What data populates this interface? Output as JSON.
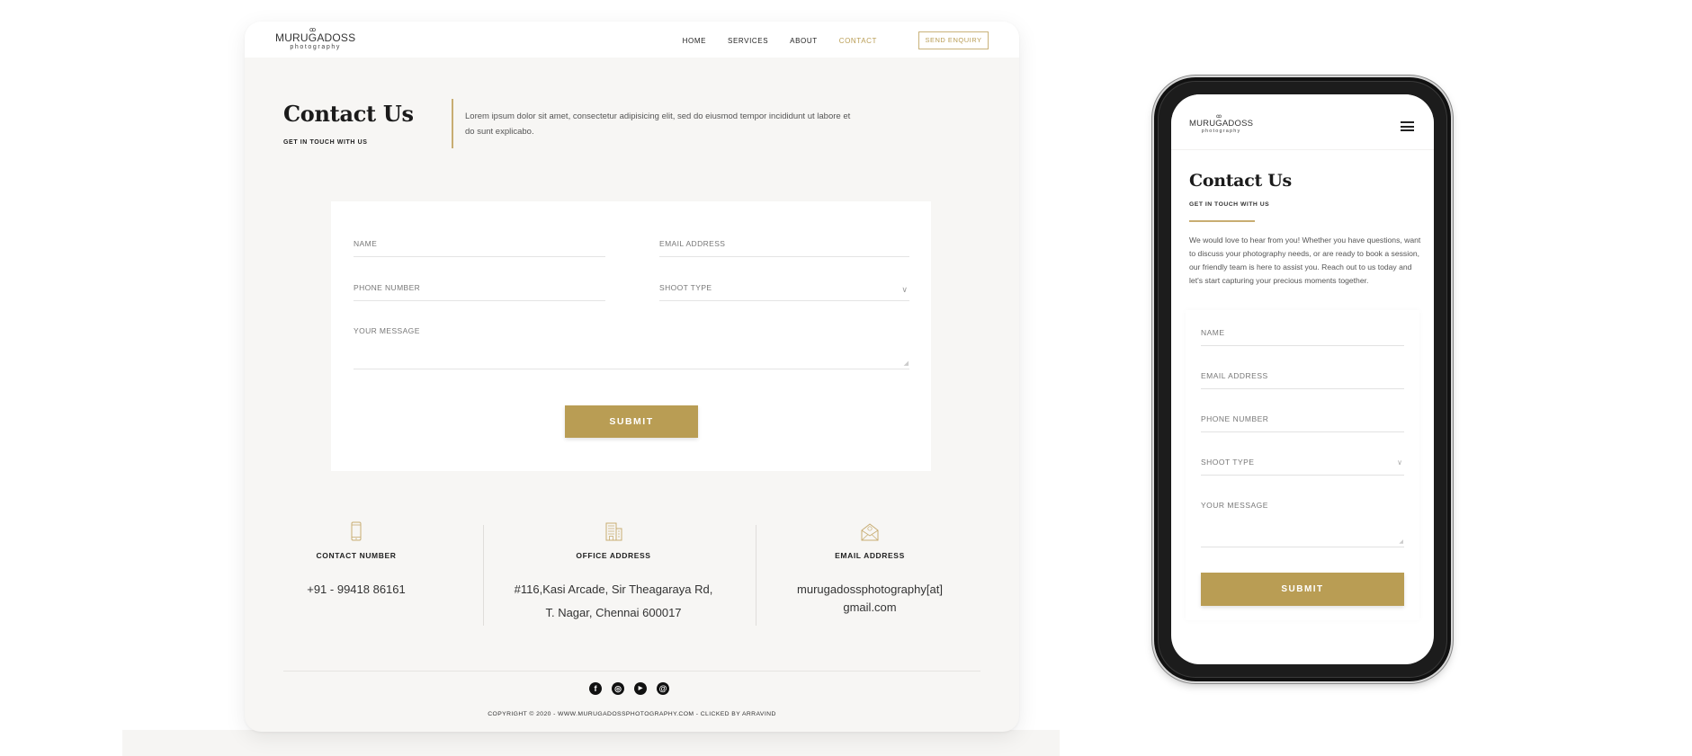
{
  "brand": {
    "logo_main": "MURUGADOSS",
    "logo_sub": "photography",
    "accent_color": "#b99d54"
  },
  "desktop": {
    "nav": [
      {
        "label": "HOME",
        "active": false
      },
      {
        "label": "SERVICES",
        "active": false
      },
      {
        "label": "ABOUT",
        "active": false
      },
      {
        "label": "CONTACT",
        "active": true
      }
    ],
    "enquiry_label": "SEND ENQUIRY",
    "title": "Contact Us",
    "subtitle": "GET IN TOUCH WITH US",
    "intro": "Lorem ipsum dolor sit amet, consectetur adipisicing elit, sed do eiusmod tempor incididunt ut labore et do sunt explicabo.",
    "form": {
      "name_placeholder": "NAME",
      "email_placeholder": "EMAIL ADDRESS",
      "phone_placeholder": "PHONE NUMBER",
      "shoot_type_placeholder": "SHOOT TYPE",
      "message_placeholder": "YOUR MESSAGE",
      "submit_label": "SUBMIT"
    },
    "info": {
      "phone": {
        "icon": "mobile-phone-icon",
        "label": "CONTACT NUMBER",
        "value": "+91 - 99418 86161"
      },
      "office": {
        "icon": "building-icon",
        "label": "OFFICE ADDRESS",
        "line1": "#116,Kasi Arcade, Sir Theagaraya Rd,",
        "line2": "T. Nagar, Chennai 600017"
      },
      "email": {
        "icon": "envelope-open-icon",
        "label": "EMAIL ADDRESS",
        "line1": "murugadossphotography[at]",
        "line2": "gmail.com"
      }
    },
    "socials": [
      {
        "name": "facebook",
        "glyph": "f"
      },
      {
        "name": "instagram",
        "glyph": "◎"
      },
      {
        "name": "youtube",
        "glyph": "▶"
      },
      {
        "name": "email",
        "glyph": "@"
      }
    ],
    "copyright": "COPYRIGHT © 2020 - WWW.MURUGADOSSPHOTOGRAPHY.COM - CLICKED BY ARRAVIND"
  },
  "mobile": {
    "title": "Contact Us",
    "subtitle": "GET IN TOUCH WITH US",
    "intro": "We would love to hear from you! Whether you have questions, want to discuss your photography needs, or are ready to book a session, our friendly team is here to assist you. Reach out to us today and let's start capturing your precious moments together.",
    "form": {
      "name_placeholder": "NAME",
      "email_placeholder": "EMAIL ADDRESS",
      "phone_placeholder": "PHONE NUMBER",
      "shoot_type_placeholder": "SHOOT TYPE",
      "message_placeholder": "YOUR MESSAGE",
      "submit_label": "SUBMIT"
    }
  }
}
